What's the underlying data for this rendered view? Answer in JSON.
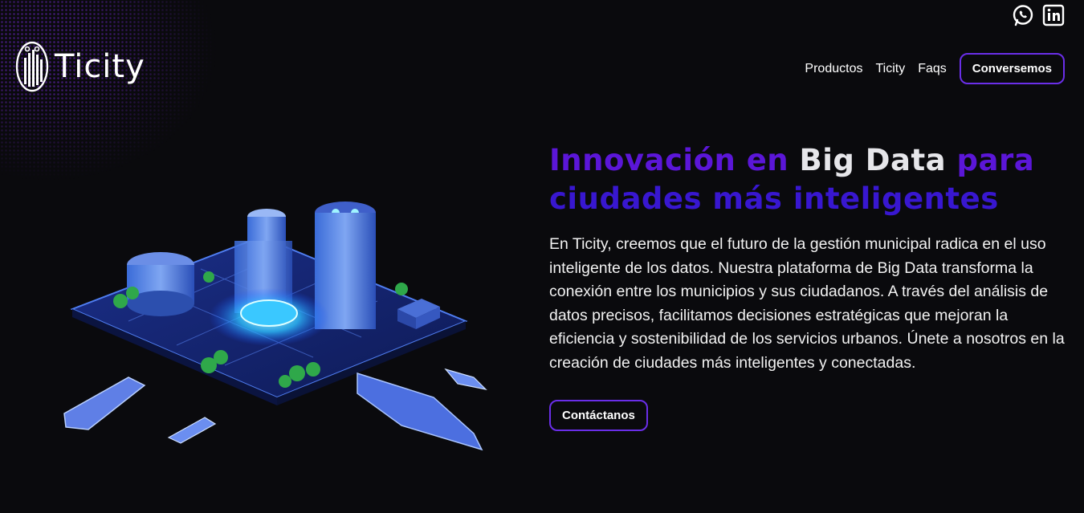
{
  "brand": {
    "name": "Ticity"
  },
  "social": {
    "whatsapp_icon": "whatsapp-icon",
    "linkedin_icon": "linkedin-icon"
  },
  "nav": {
    "items": [
      {
        "label": "Productos"
      },
      {
        "label": "Ticity"
      },
      {
        "label": "Faqs"
      }
    ],
    "cta": "Conversemos"
  },
  "hero": {
    "title_part1": "Innovación en ",
    "title_highlight": "Big Data",
    "title_part2": " para",
    "title_line2": "ciudades más inteligentes",
    "description": "En Ticity, creemos que el futuro de la gestión municipal radica en el uso inteligente de los datos. Nuestra plataforma de Big Data transforma la conexión entre los municipios y sus ciudadanos. A través del análisis de datos precisos, facilitamos decisiones estratégicas que mejoran la eficiencia y sostenibilidad de los servicios urbanos. Únete a nosotros en la creación de ciudades más inteligentes y conectadas.",
    "cta": "Contáctanos"
  },
  "colors": {
    "background": "#0a0a0d",
    "accent_purple": "#5b16d8",
    "accent_blue": "#3817d0",
    "button_border": "#6a2ee8"
  }
}
